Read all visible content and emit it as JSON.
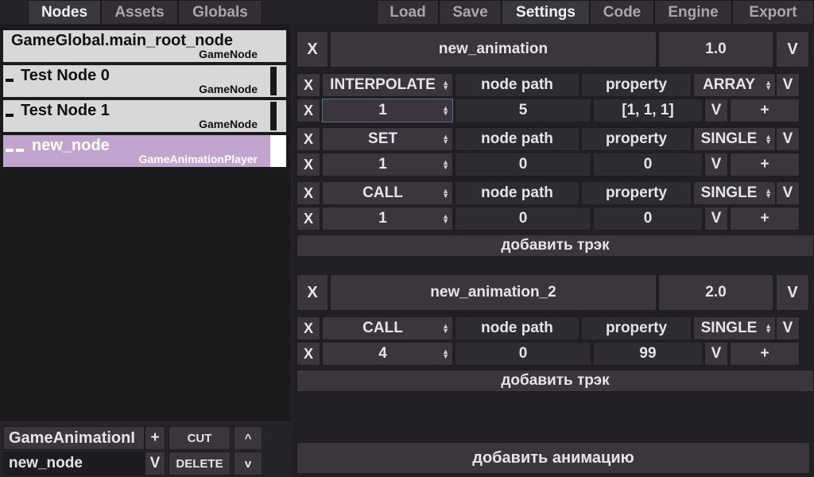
{
  "left_tabs": [
    "Nodes",
    "Assets",
    "Globals"
  ],
  "right_tabs": [
    "Load",
    "Save",
    "Settings",
    "Code",
    "Engine",
    "Export"
  ],
  "tree": {
    "root": {
      "title": "GameGlobal.main_root_node",
      "type": "GameNode"
    },
    "items": [
      {
        "title": "Test Node 0",
        "type": "GameNode"
      },
      {
        "title": "Test Node 1",
        "type": "GameNode"
      },
      {
        "title": "new_node",
        "type": "GameAnimationPlayer"
      }
    ]
  },
  "bottom_left": {
    "type_field": "GameAnimationI",
    "plus_label": "+",
    "cut_label": "CUT",
    "up_label": "^",
    "name_field": "new_node",
    "v_label": "V",
    "delete_label": "DELETE",
    "down_label": "v"
  },
  "common": {
    "x_label": "X",
    "v_label": "V",
    "plus_label": "+"
  },
  "animations": [
    {
      "name": "new_animation",
      "length": "1.0",
      "tracks": [
        {
          "kind": "INTERPOLATE",
          "path_label": "node path",
          "prop_label": "property",
          "mode": "ARRAY",
          "index": "1",
          "path_value": "5",
          "prop_value": "[1, 1, 1]"
        },
        {
          "kind": "SET",
          "path_label": "node path",
          "prop_label": "property",
          "mode": "SINGLE",
          "index": "1",
          "path_value": "0",
          "prop_value": "0"
        },
        {
          "kind": "CALL",
          "path_label": "node path",
          "prop_label": "property",
          "mode": "SINGLE",
          "index": "1",
          "path_value": "0",
          "prop_value": "0"
        }
      ],
      "add_track_label": "добавить трэк"
    },
    {
      "name": "new_animation_2",
      "length": "2.0",
      "tracks": [
        {
          "kind": "CALL",
          "path_label": "node path",
          "prop_label": "property",
          "mode": "SINGLE",
          "index": "4",
          "path_value": "0",
          "prop_value": "99"
        }
      ],
      "add_track_label": "добавить трэк"
    }
  ],
  "add_animation_label": "добавить анимацию",
  "colors": {
    "selected_node": "#c2a5cf",
    "accent_text": "#f1eff4"
  }
}
